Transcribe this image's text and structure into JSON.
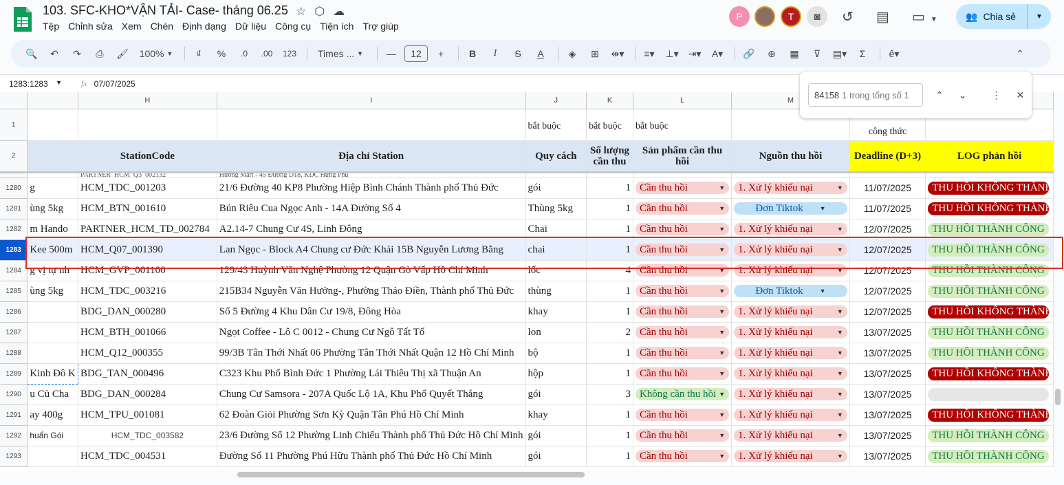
{
  "doc": {
    "title": "103. SFC-KHO*VẬN TẢI- Case- tháng 06.25"
  },
  "menu": [
    "Tệp",
    "Chỉnh sửa",
    "Xem",
    "Chèn",
    "Định dạng",
    "Dữ liệu",
    "Công cụ",
    "Tiện ích",
    "Trợ giúp"
  ],
  "avatars": [
    {
      "letter": "P",
      "color": "#f48fb1"
    },
    {
      "letter": "",
      "color": "#8d6e63"
    },
    {
      "letter": "T",
      "color": "#b71c1c"
    }
  ],
  "share": {
    "label": "Chia sẻ"
  },
  "toolbar": {
    "zoom": "100%",
    "currency": "₫",
    "percent": "%",
    "dec_dec": ".0",
    "dec_inc": ".00",
    "num_format": "123",
    "font": "Times ...",
    "font_size": "12"
  },
  "formula_bar": {
    "namebox": "1283:1283",
    "value": "07/07/2025"
  },
  "find": {
    "value": "84158",
    "count": "1 trong tổng số 1"
  },
  "columns": [
    "H",
    "I",
    "J",
    "K",
    "L",
    "M",
    "",
    ""
  ],
  "header_row1": {
    "rownum": "1",
    "J": "bắt buộc",
    "K": "bắt buộc",
    "L": "bắt buộc",
    "N": "công thức"
  },
  "header_row2": {
    "rownum": "2",
    "H": "StationCode",
    "I": "Địa chỉ Station",
    "J": "Quy cách",
    "K": "Số lượng cần thu",
    "L": "Sản phẩm cần thu hồi",
    "M": "Nguồn thu hồi",
    "N": "Deadline (D+3)",
    "O": "LOG phản hồi"
  },
  "partial_row": {
    "H": "PARTNER_HCM_Q3_002132",
    "I": "Hương Mart - 45 Đường D18, KDC Hưng Phú"
  },
  "rows": [
    {
      "num": "1280",
      "g": "g",
      "h": "HCM_TDC_001203",
      "i": "21/6 Đường 40 KP8 Phường Hiệp Bình Chánh Thành phố Thủ Đức",
      "j": "gói",
      "k": "1",
      "l": "Cần thu hồi",
      "m": "1. Xử lý khiếu nại",
      "n": "11/07/2025",
      "o": "THU HỒI KHÔNG THÀNH CÔNG"
    },
    {
      "num": "1281",
      "g": "ùng 5kg",
      "h": "HCM_BTN_001610",
      "i": "Bún Riêu Cua Ngọc Anh - 14A Đường Số 4",
      "j": "Thùng 5kg",
      "k": "1",
      "l": "Cần thu hồi",
      "m": "Đơn Tiktok",
      "n": "11/07/2025",
      "o": "THU HỒI KHÔNG THÀNH CÔNG"
    },
    {
      "num": "1282",
      "g": "m Hando",
      "h": "PARTNER_HCM_TD_002784",
      "i": "A2.14-7 Chung Cư 4S, Linh Đông",
      "j": "Chai",
      "k": "1",
      "l": "Cần thu hồi",
      "m": "1. Xử lý khiếu nại",
      "n": "12/07/2025",
      "o": "THU HỒI THÀNH CÔNG"
    },
    {
      "num": "1283",
      "g": "Kee 500m",
      "h": "HCM_Q07_001390",
      "i": "Lan Ngọc - Block A4 Chung cư Đức Khải 15B Nguyễn Lương Bằng",
      "j": "chai",
      "k": "1",
      "l": "Cần thu hồi",
      "m": "1. Xử lý khiếu nại",
      "n": "12/07/2025",
      "o": "THU HỒI THÀNH CÔNG"
    },
    {
      "num": "1284",
      "g": "g vị tự nh",
      "h": "HCM_GVP_001100",
      "i": "129/43 Huỳnh Văn Nghệ Phường 12 Quận Gò Vấp Hồ Chí Minh",
      "j": "lốc",
      "k": "4",
      "l": "Cần thu hồi",
      "m": "1. Xử lý khiếu nại",
      "n": "12/07/2025",
      "o": "THU HỒI THÀNH CÔNG"
    },
    {
      "num": "1285",
      "g": "ùng 5kg",
      "h": "HCM_TDC_003216",
      "i": "215B34 Nguyễn Văn Hưởng-, Phường Thảo Điền, Thành phố Thủ Đức",
      "j": "thùng",
      "k": "1",
      "l": "Cần thu hồi",
      "m": "Đơn Tiktok",
      "n": "12/07/2025",
      "o": "THU HỒI THÀNH CÔNG"
    },
    {
      "num": "1286",
      "g": "",
      "h": "BDG_DAN_000280",
      "i": "Số 5 Đường 4 Khu Dân Cư 19/8, Đông Hòa",
      "j": "khay",
      "k": "1",
      "l": "Cần thu hồi",
      "m": "1. Xử lý khiếu nại",
      "n": "12/07/2025",
      "o": "THU HỒI KHÔNG THÀNH CÔNG"
    },
    {
      "num": "1287",
      "g": "",
      "h": "HCM_BTH_001066",
      "i": "Ngọt Coffee - Lô C 0012 - Chung Cư Ngô Tất Tố",
      "j": "lon",
      "k": "2",
      "l": "Cần thu hồi",
      "m": "1. Xử lý khiếu nại",
      "n": "13/07/2025",
      "o": "THU HỒI THÀNH CÔNG"
    },
    {
      "num": "1288",
      "g": "",
      "h": "HCM_Q12_000355",
      "i": "99/3B Tân Thới Nhất 06 Phường Tân Thới Nhất Quận 12 Hồ Chí Minh",
      "j": "bộ",
      "k": "1",
      "l": "Cần thu hồi",
      "m": "1. Xử lý khiếu nại",
      "n": "13/07/2025",
      "o": "THU HỒI THÀNH CÔNG"
    },
    {
      "num": "1289",
      "g": "Kinh Đô K",
      "h": "BDG_TAN_000496",
      "i": "C323 Khu Phố Bình Đức 1 Phường Lái Thiêu Thị xã Thuận An",
      "j": "hộp",
      "k": "1",
      "l": "Cần thu hồi",
      "m": "1. Xử lý khiếu nại",
      "n": "13/07/2025",
      "o": "THU HỒI KHÔNG THÀNH CÔNG"
    },
    {
      "num": "1290",
      "g": "u Củ Cha",
      "h": "BDG_DAN_000284",
      "i": "Chung Cư Samsora - 207A Quốc Lộ 1A, Khu Phố Quyết Thắng",
      "j": "gói",
      "k": "3",
      "l": "Không cần thu hồi",
      "m": "1. Xử lý khiếu nại",
      "n": "13/07/2025",
      "o": ""
    },
    {
      "num": "1291",
      "g": "ay 400g",
      "h": "HCM_TPU_001081",
      "i": "62 Đoàn Giỏi Phường Sơn Kỳ Quận Tân Phú Hồ Chí Minh",
      "j": "khay",
      "k": "1",
      "l": "Cần thu hồi",
      "m": "1. Xử lý khiếu nại",
      "n": "13/07/2025",
      "o": "THU HỒI KHÔNG THÀNH CÔNG"
    },
    {
      "num": "1292",
      "g": "huẩn Gói",
      "h": "HCM_TDC_003582",
      "i": "23/6 Đường Số 12 Phường Linh Chiểu Thành phố Thủ Đức Hồ Chí Minh",
      "j": "gói",
      "k": "1",
      "l": "Cần thu hồi",
      "m": "1. Xử lý khiếu nại",
      "n": "13/07/2025",
      "o": "THU HỒI THÀNH CÔNG"
    },
    {
      "num": "1293",
      "g": "",
      "h": "HCM_TDC_004531",
      "i": "Đường Số 11 Phường Phú Hữu Thành phố Thủ Đức Hồ Chí Minh",
      "j": "gói",
      "k": "1",
      "l": "Cần thu hồi",
      "m": "1. Xử lý khiếu nại",
      "n": "13/07/2025",
      "o": "THU HỒI THÀNH CÔNG"
    }
  ]
}
